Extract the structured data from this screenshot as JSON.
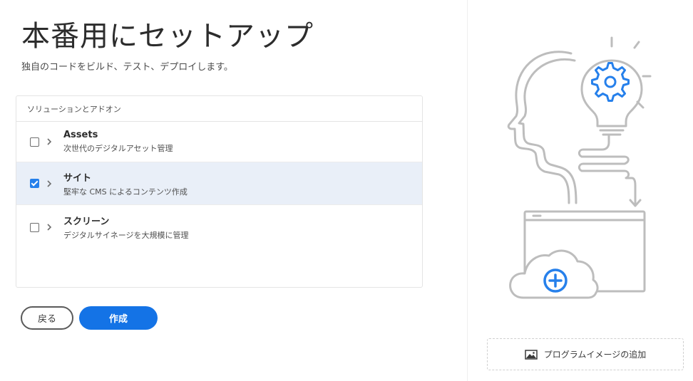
{
  "header": {
    "title": "本番用にセットアップ",
    "subtitle": "独自のコードをビルド、テスト、デプロイします。"
  },
  "solutions": {
    "heading": "ソリューションとアドオン",
    "items": [
      {
        "title": "Assets",
        "description": "次世代のデジタルアセット管理",
        "checked": false
      },
      {
        "title": "サイト",
        "description": "堅牢な CMS によるコンテンツ作成",
        "checked": true
      },
      {
        "title": "スクリーン",
        "description": "デジタルサイネージを大規模に管理",
        "checked": false
      }
    ]
  },
  "actions": {
    "back_label": "戻る",
    "create_label": "作成"
  },
  "sidebar": {
    "add_image_label": "プログラムイメージの追加",
    "image_icon": "image-icon"
  },
  "colors": {
    "accent": "#1473e6",
    "selected_row": "#e9eff8",
    "illustration_gray": "#bdbdbd",
    "illustration_blue": "#2680eb"
  }
}
